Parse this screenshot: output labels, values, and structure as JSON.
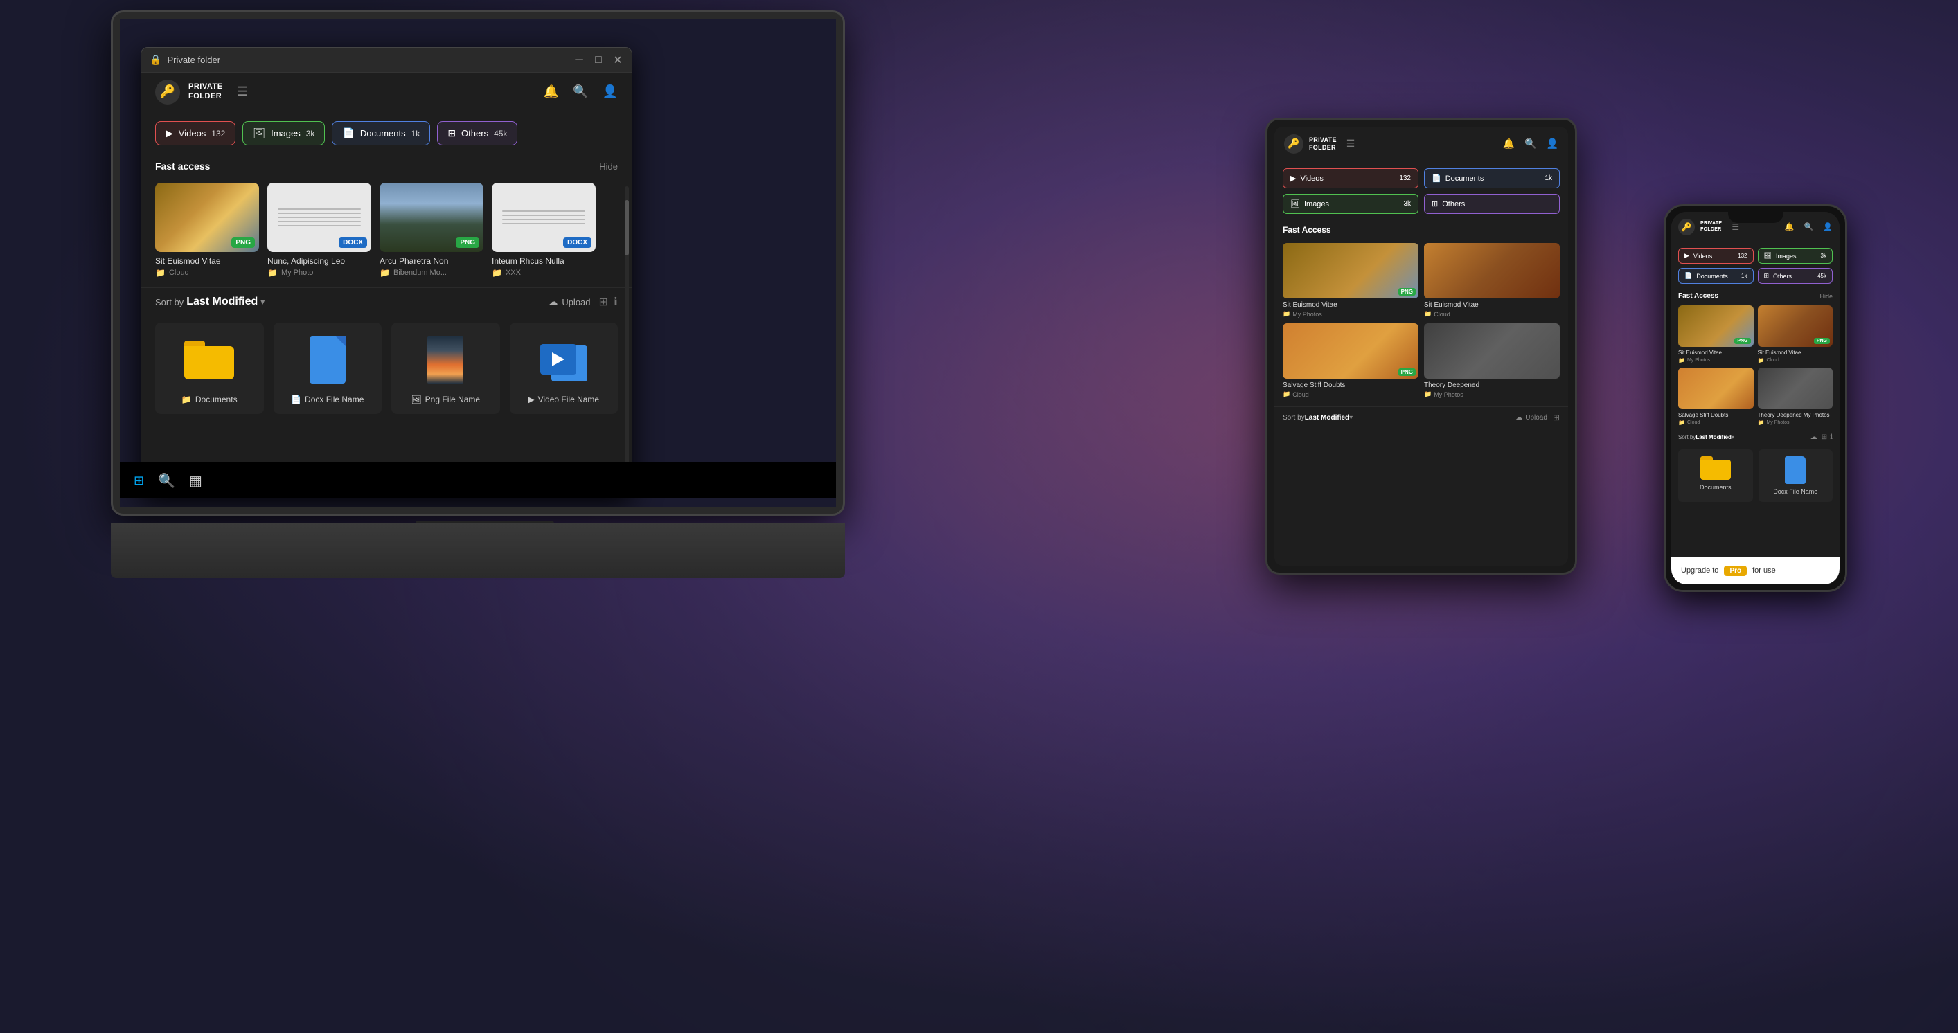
{
  "background": {
    "color": "#1a1a2e"
  },
  "laptop": {
    "titlebar": {
      "icon": "🔒",
      "title": "Private folder",
      "controls": [
        "─",
        "□",
        "✕"
      ]
    },
    "app": {
      "logo": "🔑",
      "title_line1": "PRIVATE",
      "title_line2": "FOLDER",
      "hamburger": "☰",
      "bell": "🔔",
      "search": "🔍",
      "profile": "👤",
      "categories": [
        {
          "id": "videos",
          "icon": "▶",
          "label": "Videos",
          "count": "132",
          "type": "videos"
        },
        {
          "id": "images",
          "icon": "🖼",
          "label": "Images",
          "count": "3k",
          "type": "images"
        },
        {
          "id": "documents",
          "icon": "📄",
          "label": "Documents",
          "count": "1k",
          "type": "documents"
        },
        {
          "id": "others",
          "icon": "⊞",
          "label": "Others",
          "count": "45k",
          "type": "others"
        }
      ],
      "fast_access": {
        "title": "Fast access",
        "hide_label": "Hide",
        "items": [
          {
            "name": "Sit Euismod Vitae",
            "folder": "Cloud",
            "badge": "PNG",
            "badge_type": "png",
            "thumb": "person"
          },
          {
            "name": "Nunc, Adipiscing Leo",
            "folder": "My Photo",
            "badge": "DOCX",
            "badge_type": "docx",
            "thumb": "doc"
          },
          {
            "name": "Arcu Pharetra Non",
            "folder": "Bibendum Mo...",
            "badge": "PNG",
            "badge_type": "png",
            "thumb": "windmill"
          },
          {
            "name": "Inteum Rhcus Nulla",
            "folder": "XXX",
            "badge": "DOCX",
            "badge_type": "docx",
            "thumb": "doc2"
          }
        ]
      },
      "sort_bar": {
        "prefix": "Sort by",
        "value": "Last Modified",
        "upload": "Upload"
      },
      "files": [
        {
          "name": "Documents",
          "type": "folder",
          "icon_type": "folder"
        },
        {
          "name": "Docx File Name",
          "type": "docx",
          "icon_type": "docx"
        },
        {
          "name": "Png File Name",
          "type": "png",
          "icon_type": "png"
        },
        {
          "name": "Video File Name",
          "type": "video",
          "icon_type": "video"
        }
      ]
    },
    "taskbar": {
      "items": [
        "⊞",
        "🔍",
        "▦"
      ]
    }
  },
  "tablet": {
    "app": {
      "logo": "🔑",
      "title_line1": "PRIVATE",
      "title_line2": "FOLDER",
      "categories": [
        {
          "label": "Videos",
          "count": "132",
          "type": "videos"
        },
        {
          "label": "Documents",
          "count": "1k",
          "type": "documents"
        },
        {
          "label": "Images",
          "count": "3k",
          "type": "images"
        },
        {
          "label": "Others",
          "type": "others"
        }
      ],
      "fast_access": {
        "title": "Fast Access",
        "items": [
          {
            "name": "Sit Euismod Vitae",
            "folder": "My Photos",
            "badge": "PNG",
            "badge_type": "png",
            "thumb": "person"
          },
          {
            "name": "Sit Euismod Vitae",
            "folder": "Cloud",
            "thumb": "staircase"
          },
          {
            "name": "Salvage Stiff Doubts",
            "folder": "Cloud",
            "badge": "PNG",
            "badge_type": "png",
            "thumb": "group"
          },
          {
            "name": "Theory Deepened",
            "folder": "My Photos",
            "thumb": "theory"
          }
        ]
      },
      "sort_bar": {
        "prefix": "Sort by",
        "value": "Last Modified"
      }
    }
  },
  "phone": {
    "app": {
      "logo": "🔑",
      "title_line1": "PRIVATE",
      "title_line2": "FOLDER",
      "categories": [
        {
          "label": "Videos",
          "count": "132",
          "type": "videos"
        },
        {
          "label": "Images",
          "count": "3k",
          "type": "images"
        },
        {
          "label": "Documents",
          "count": "1k",
          "type": "documents"
        },
        {
          "label": "Others",
          "count": "45k",
          "type": "others"
        }
      ],
      "fast_access": {
        "title": "Fast Access",
        "hide_label": "Hide",
        "items": [
          {
            "name": "Sit Euismod Vitae",
            "folder": "My Photos",
            "badge": "PNG",
            "badge_type": "png",
            "thumb": "person"
          },
          {
            "name": "Sit Euismod Vitae",
            "folder": "Cloud",
            "badge": "PNG",
            "badge_type": "png",
            "thumb": "staircase"
          },
          {
            "name": "Salvage Stiff Doubts",
            "folder": "Cloud",
            "thumb": "group"
          },
          {
            "name": "Theory Deepened My Photos",
            "folder": "My Photos",
            "thumb": "theory"
          }
        ]
      },
      "sort_bar": {
        "prefix": "Sort by",
        "value": "Last Modified"
      },
      "files": [
        {
          "name": "Documents",
          "type": "folder"
        },
        {
          "name": "Docx File Name",
          "type": "docx"
        }
      ],
      "upgrade": {
        "text": "Upgrade to",
        "pro_label": "Pro",
        "suffix": "for use"
      }
    }
  }
}
